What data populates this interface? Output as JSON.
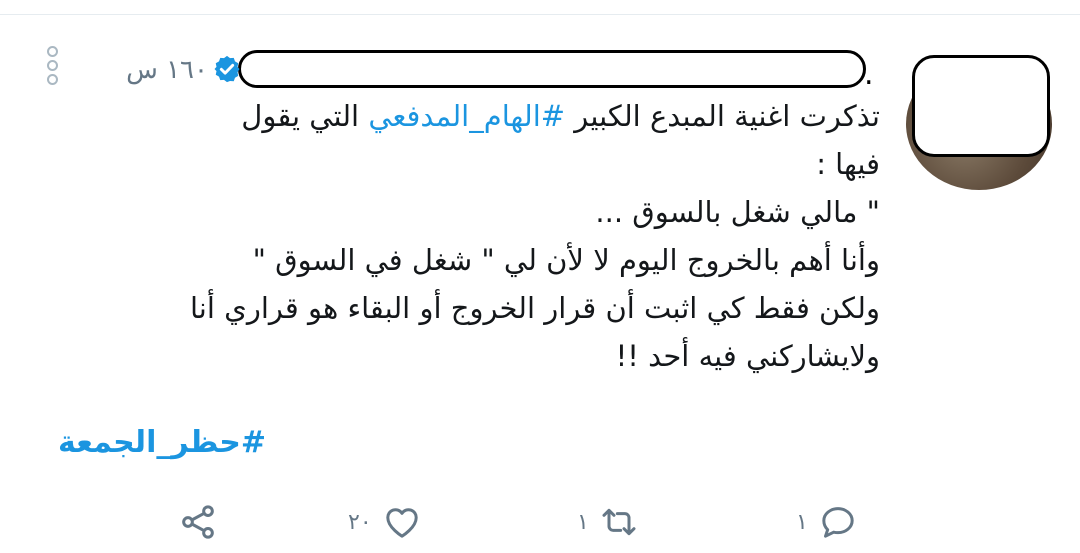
{
  "tweet": {
    "name_suffix": ".",
    "time": "١٦٠ س",
    "body": {
      "line1_a": "تذكرت اغنية المبدع الكبير ",
      "line1_hashtag": "#الهام_المدفعي",
      "line1_b": " التي يقول",
      "line2": "فيها :",
      "line3": "\" مالي شغل  بالسوق ...",
      "line4": "وأنا أهم  بالخروج اليوم لا لأن لي \" شغل في السوق \"",
      "line5": "ولكن  فقط كي اثبت أن قرار الخروج أو البقاء هو قراري أنا",
      "line6": "ولايشاركني فيه أحد !!"
    },
    "hashtag_line": "#حظر_الجمعة"
  },
  "actions": {
    "reply_count": "١",
    "retweet_count": "١",
    "like_count": "٢٠"
  },
  "colors": {
    "accent": "#1b95e0",
    "muted": "#657786"
  },
  "icons": [
    "verified-icon",
    "more-options-icon",
    "reply-icon",
    "retweet-icon",
    "like-icon",
    "share-icon"
  ]
}
